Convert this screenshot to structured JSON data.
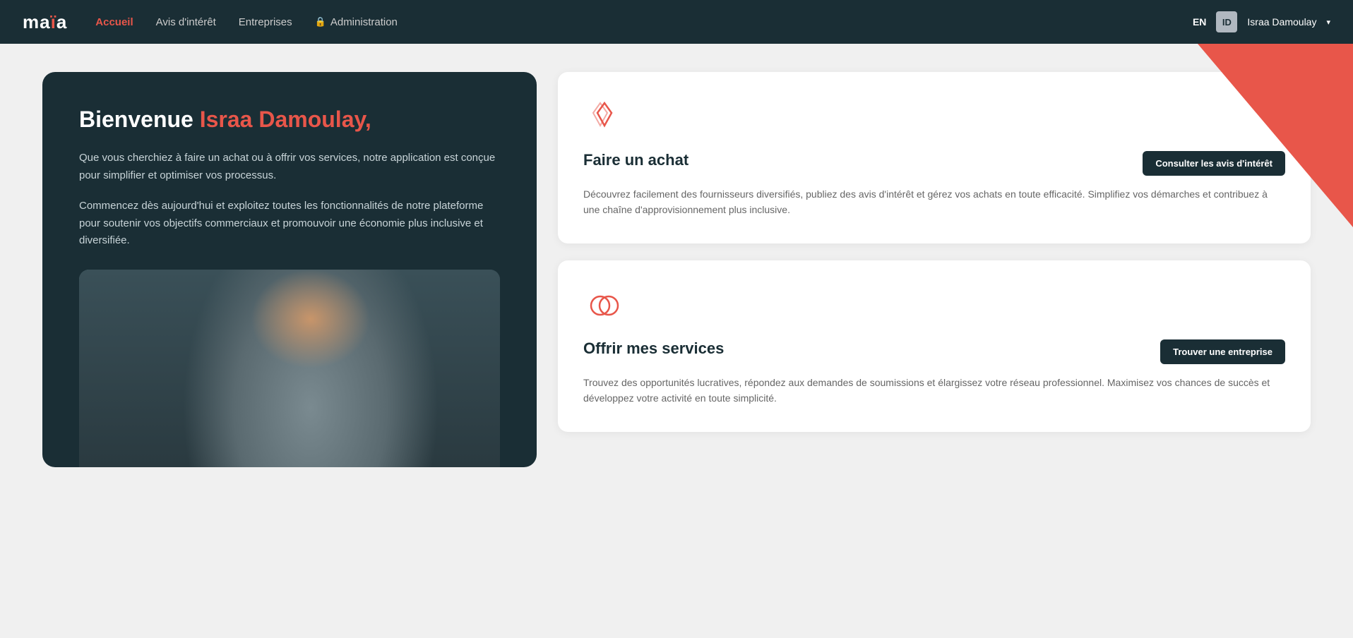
{
  "navbar": {
    "logo": "maïa",
    "links": [
      {
        "label": "Accueil",
        "active": true
      },
      {
        "label": "Avis d'intérêt",
        "active": false
      },
      {
        "label": "Entreprises",
        "active": false
      },
      {
        "label": "Administration",
        "active": false,
        "hasLock": true
      }
    ],
    "lang": "EN",
    "user": {
      "name": "Israa Damoulay",
      "initials": "ID"
    }
  },
  "hero": {
    "welcome_prefix": "Bienvenue ",
    "welcome_name": "Israa Damoulay,",
    "para1": "Que vous cherchiez à faire un achat ou à offrir vos services, notre application est conçue pour simplifier et optimiser vos processus.",
    "para2": "Commencez dès aujourd'hui et exploitez toutes les fonctionnalités de notre plateforme pour soutenir vos objectifs commerciaux et promouvoir une économie plus inclusive et diversifiée."
  },
  "cards": [
    {
      "id": "purchase",
      "title": "Faire un achat",
      "description": "Découvrez facilement des fournisseurs diversifiés, publiez des avis d'intérêt et gérez vos achats en toute efficacité. Simplifiez vos démarches et contribuez à une chaîne d'approvisionnement plus inclusive.",
      "button_label": "Consulter les avis d'intérêt"
    },
    {
      "id": "services",
      "title": "Offrir mes services",
      "description": "Trouvez des opportunités lucratives, répondez aux demandes de soumissions et élargissez votre réseau professionnel. Maximisez vos chances de succès et développez votre activité en toute simplicité.",
      "button_label": "Trouver une entreprise"
    }
  ],
  "icons": {
    "diamond": "diamond-icon",
    "circles": "circles-icon",
    "lock": "🔒",
    "chevron_down": "▾"
  }
}
